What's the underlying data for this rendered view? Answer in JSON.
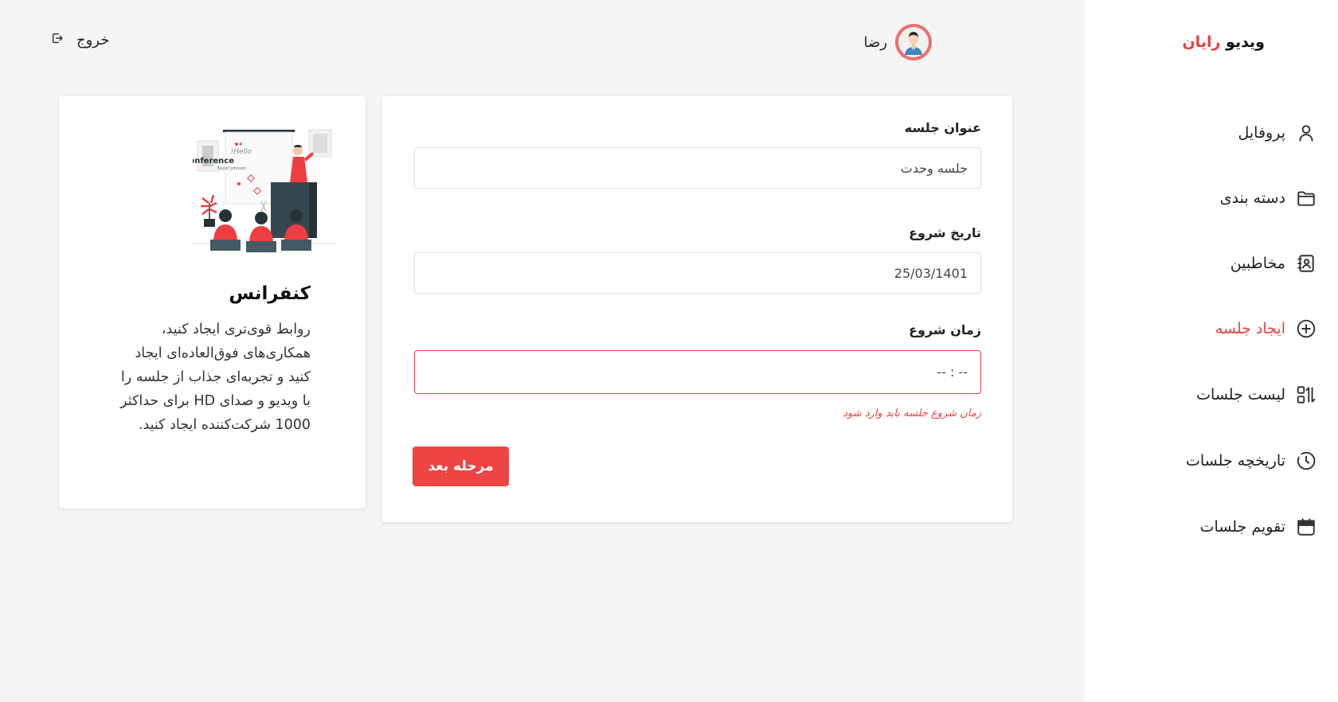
{
  "brand": {
    "part1": "ویدیو",
    "part2": "رایان",
    "accent_color": "#ef3e42"
  },
  "sidebar": {
    "items": [
      {
        "label": "پروفایل",
        "icon": "user-icon"
      },
      {
        "label": "دسته بندی",
        "icon": "folder-icon"
      },
      {
        "label": "مخاطبین",
        "icon": "contacts-icon"
      },
      {
        "label": "ایجاد جلسه",
        "icon": "plus-circle-icon",
        "active": true
      },
      {
        "label": "لیست جلسات",
        "icon": "list-sort-icon"
      },
      {
        "label": "تاریخچه جلسات",
        "icon": "history-icon"
      },
      {
        "label": "تقویم جلسات",
        "icon": "calendar-icon"
      }
    ]
  },
  "header": {
    "user_name": "رضا",
    "logout_label": "خروج"
  },
  "form": {
    "title_label": "عنوان جلسه",
    "title_value": "جلسه وحدت",
    "date_label": "تاریخ شروع",
    "date_value": "25/03/1401",
    "time_label": "زمان شروع",
    "time_value": "-- : --",
    "time_error": "زمان شروع جلسه باید وارد شود",
    "next_button": "مرحله بعد"
  },
  "info": {
    "title": "کنفرانس",
    "body": "روابط قوی‌تری ایجاد کنید، همکاری‌های فوق‌العاده‌ای ایجاد کنید و تجربه‌ای جذاب از جلسه را با ویدیو و صدای HD برای حداکثر 1000 شرکت‌کننده ایجاد کنید.",
    "illustration": {
      "board_line1": "Hello!",
      "board_line2": "Conference",
      "board_line3": "Taylor Johnson"
    }
  }
}
